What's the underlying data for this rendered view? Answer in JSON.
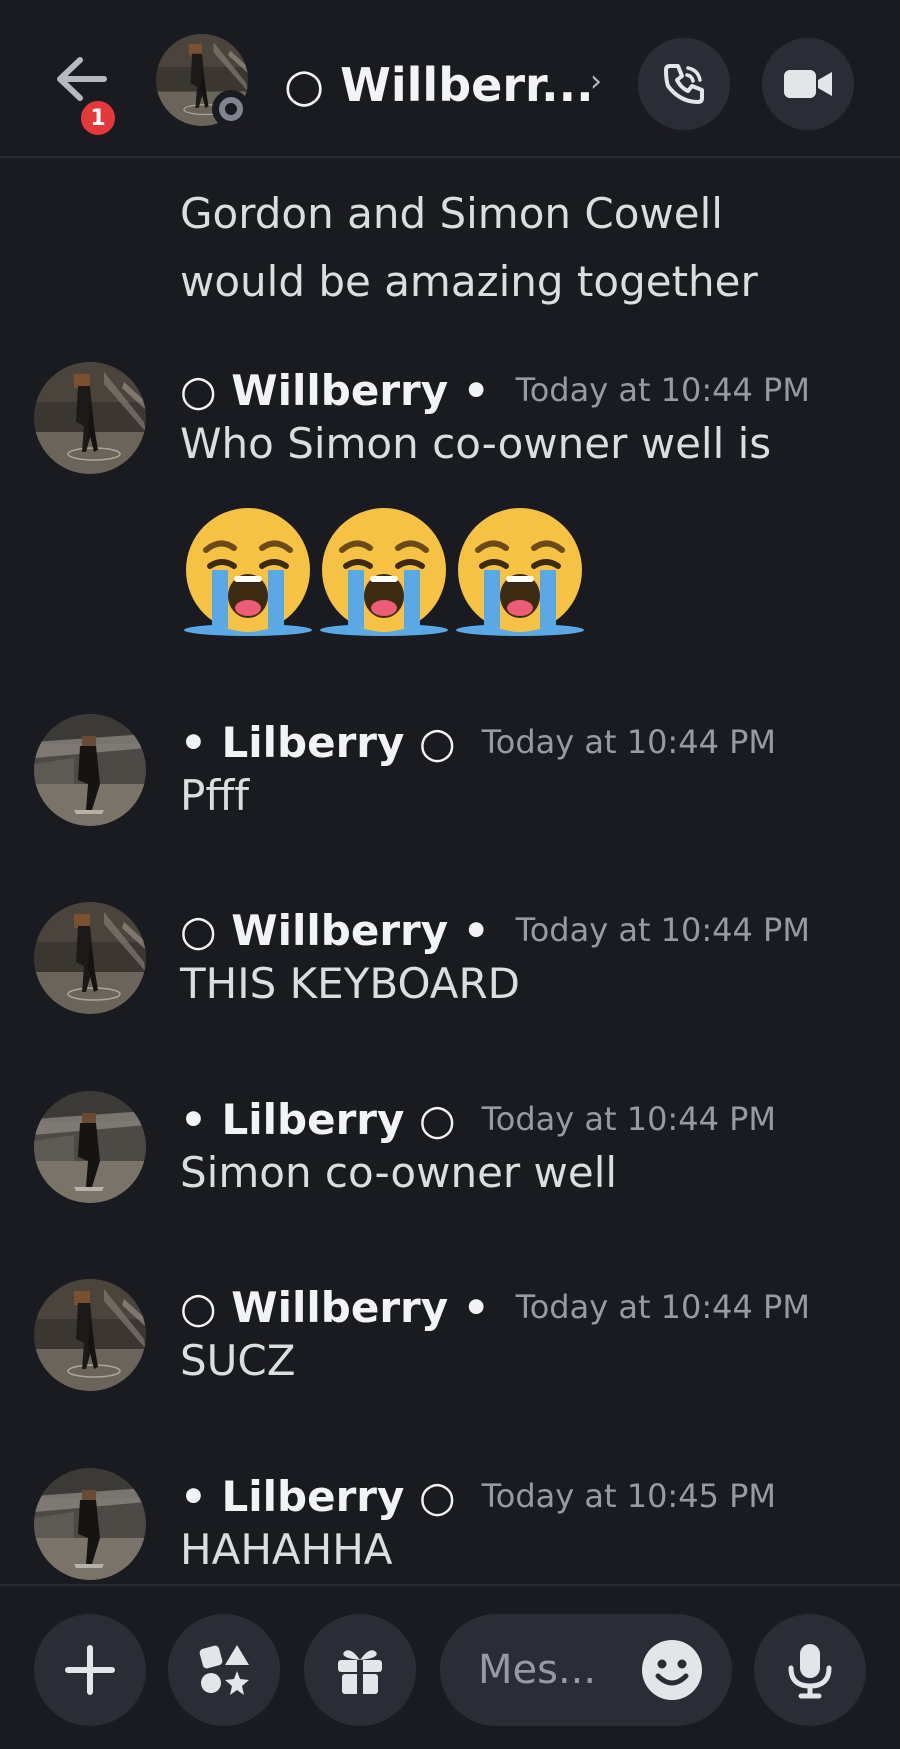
{
  "header": {
    "notification_count": "1",
    "title": "○ Willberr...",
    "chevron": "›"
  },
  "messages": {
    "continued_text": "Gordon and Simon Cowell would be amazing together",
    "items": [
      {
        "author": "○ Willberry •",
        "time": "Today at 10:44 PM",
        "text": "Who Simon co-owner well is",
        "avatar": "willberry"
      },
      {
        "author": "• Lilberry ○",
        "time": "Today at 10:44 PM",
        "text": "Pfff",
        "avatar": "lilberry"
      },
      {
        "author": "○ Willberry •",
        "time": "Today at 10:44 PM",
        "text": "THIS KEYBOARD",
        "avatar": "willberry"
      },
      {
        "author": "• Lilberry ○",
        "time": "Today at 10:44 PM",
        "text": "Simon co-owner well",
        "avatar": "lilberry"
      },
      {
        "author": "○ Willberry •",
        "time": "Today at 10:44 PM",
        "text": "SUCZ",
        "avatar": "willberry"
      },
      {
        "author": "• Lilberry ○",
        "time": "Today at 10:45 PM",
        "text": "HAHAHHA",
        "avatar": "lilberry"
      }
    ],
    "emoji_reaction": [
      "loudly-crying-face-icon",
      "loudly-crying-face-icon",
      "loudly-crying-face-icon"
    ]
  },
  "composer": {
    "placeholder": "Mes..."
  },
  "colors": {
    "background": "#1a1b20",
    "button_bg": "#2b2d36",
    "badge": "#e5383b",
    "muted_text": "#949ba4"
  }
}
